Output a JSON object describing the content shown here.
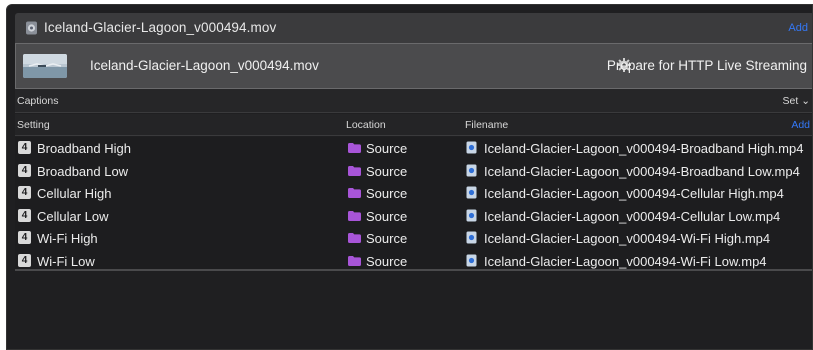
{
  "header": {
    "title": "Iceland-Glacier-Lagoon_v000494.mov",
    "add_label": "Add"
  },
  "preset_bar": {
    "name": "Iceland-Glacier-Lagoon_v000494.mov",
    "action_label": "Prepare for HTTP Live Streaming"
  },
  "captions": {
    "label": "Captions",
    "set_label": "Set ⌄"
  },
  "table": {
    "columns": {
      "setting": "Setting",
      "location": "Location",
      "filename": "Filename"
    },
    "add_label": "Add",
    "rows": [
      {
        "badge": "4",
        "setting": "Broadband High",
        "location": "Source",
        "filename": "Iceland-Glacier-Lagoon_v000494-Broadband High.mp4"
      },
      {
        "badge": "4",
        "setting": "Broadband Low",
        "location": "Source",
        "filename": "Iceland-Glacier-Lagoon_v000494-Broadband Low.mp4"
      },
      {
        "badge": "4",
        "setting": "Cellular High",
        "location": "Source",
        "filename": "Iceland-Glacier-Lagoon_v000494-Cellular High.mp4"
      },
      {
        "badge": "4",
        "setting": "Cellular Low",
        "location": "Source",
        "filename": "Iceland-Glacier-Lagoon_v000494-Cellular Low.mp4"
      },
      {
        "badge": "4",
        "setting": "Wi-Fi High",
        "location": "Source",
        "filename": "Iceland-Glacier-Lagoon_v000494-Wi-Fi High.mp4"
      },
      {
        "badge": "4",
        "setting": "Wi-Fi Low",
        "location": "Source",
        "filename": "Iceland-Glacier-Lagoon_v000494-Wi-Fi Low.mp4"
      }
    ]
  },
  "colors": {
    "accent": "#3478f6",
    "folder": "#a855d8",
    "background": "#1f1f21"
  },
  "icons": {
    "file": "movie-file-icon",
    "gear": "gear-icon",
    "folder": "folder-icon",
    "document": "document-icon"
  }
}
